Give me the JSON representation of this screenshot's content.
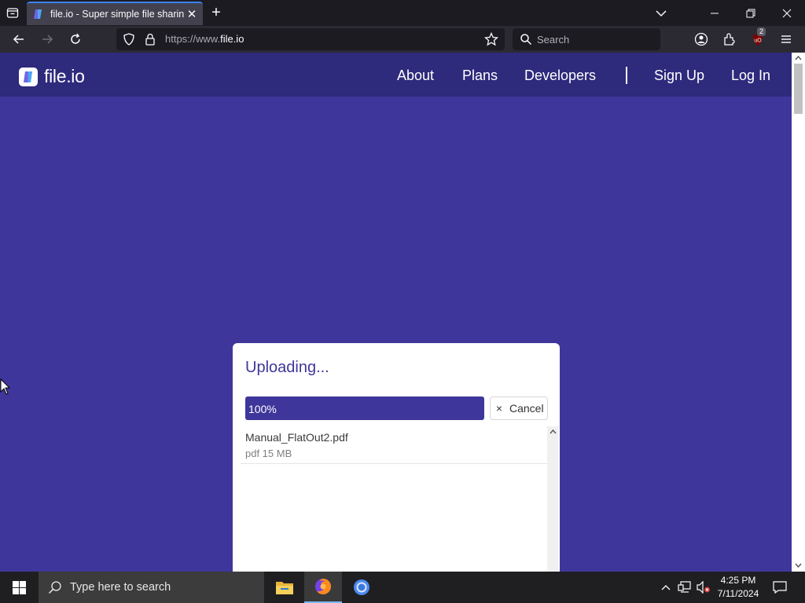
{
  "browser": {
    "tab_title": "file.io - Super simple file sharing",
    "url_prefix": "https://www.",
    "url_domain": "file.io",
    "search_placeholder": "Search",
    "extension_badge": "2"
  },
  "site": {
    "logo_text": "file.io",
    "nav": {
      "about": "About",
      "plans": "Plans",
      "developers": "Developers",
      "sign_up": "Sign Up",
      "log_in": "Log In"
    }
  },
  "upload": {
    "title": "Uploading...",
    "progress_label": "100%",
    "progress_value": 1.0,
    "cancel_icon": "×",
    "cancel_label": "Cancel",
    "files": [
      {
        "name": "Manual_FlatOut2.pdf",
        "meta": "pdf 15 MB"
      }
    ]
  },
  "taskbar": {
    "search_placeholder": "Type here to search",
    "time": "4:25 PM",
    "date": "7/11/2024"
  },
  "colors": {
    "brand": "#3f369b",
    "header": "#2e2a7c",
    "progress_accent": "#3f369b",
    "tab_accent": "#3b82f6"
  }
}
